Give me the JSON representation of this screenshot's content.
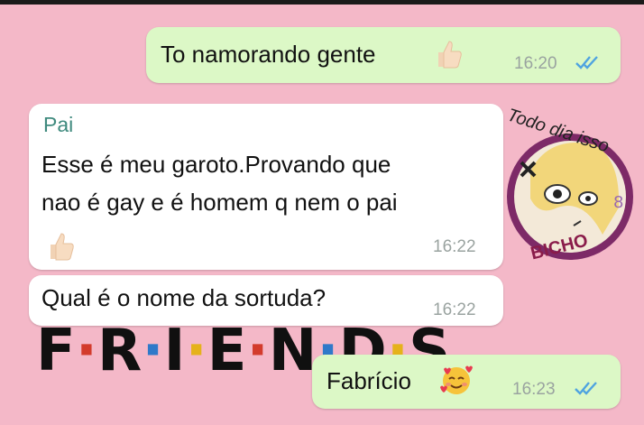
{
  "colors": {
    "background": "#f4b8c8",
    "outgoing_bubble": "#dcf8c6",
    "incoming_bubble": "#ffffff",
    "sender_name": "#3f8a7e",
    "read_ticks": "#4fa3e0"
  },
  "messages": [
    {
      "direction": "outgoing",
      "text": "To namorando gente",
      "emoji": "thumbs-up-icon",
      "time": "16:20",
      "status": "read"
    },
    {
      "direction": "incoming",
      "sender": "Pai",
      "text_lines": [
        "Esse é meu garoto.Provando que",
        "nao é gay e é homem q nem o pai"
      ],
      "emoji": "thumbs-up-icon",
      "time": "16:22"
    },
    {
      "direction": "incoming",
      "text": "Qual é o nome da sortuda?",
      "time": "16:22"
    },
    {
      "direction": "outgoing",
      "text": "Fabrício",
      "emoji": "smiling-face-with-hearts-icon",
      "time": "16:23",
      "status": "read"
    }
  ],
  "background_logo": {
    "text": "F·R·I·E·N·D·S"
  },
  "sticker": {
    "top_text": "Todo dia isso",
    "bottom_text": "BICHO"
  }
}
